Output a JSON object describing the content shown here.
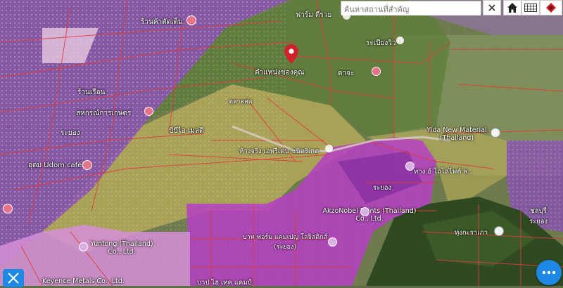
{
  "search": {
    "placeholder": "ค้นหาสถานที่สำคัญ"
  },
  "toolbar": {
    "clear_icon": "close-icon",
    "home_icon": "home-icon",
    "grid_icon": "keyboard-grid-icon",
    "layers_icon": "layers-icon"
  },
  "map": {
    "places": [
      {
        "name": "ร้านค้าตัดเต็ม",
        "type": "poi"
      },
      {
        "name": "ฟาร์ม ตีรวย",
        "type": "poi"
      },
      {
        "name": "ระเบียงวิว",
        "type": "poi"
      },
      {
        "name": "ตำแหน่งของคุณ",
        "type": "pin"
      },
      {
        "name": "ดาจะ",
        "type": "poi"
      },
      {
        "name": "ตลาดสด",
        "type": "road"
      },
      {
        "name": "ร้านเรือน",
        "type": "poi"
      },
      {
        "name": "สหกรณ์การเกษตร",
        "type": "poi"
      },
      {
        "name": "ระยอง",
        "type": "label"
      },
      {
        "name": "บีบีไอ เมลติ",
        "type": "poi"
      },
      {
        "name": "Yida New Material (Thailand)",
        "type": "poi"
      },
      {
        "name": "ห้างจริง เอพรีเด่น ชนิดริเกต",
        "type": "poi"
      },
      {
        "name": "อุดม Udom café",
        "type": "poi"
      },
      {
        "name": "ทาง อ์ โอโลไฟต์ พ..",
        "type": "poi"
      },
      {
        "name": "ระยอง",
        "type": "label"
      },
      {
        "name": "AkzoNobel Paints (Thailand) Co., Ltd.",
        "type": "poi"
      },
      {
        "name": "ชลบุรี ระยอง",
        "type": "label"
      },
      {
        "name": "ทุ่งกะราเภา",
        "type": "poi"
      },
      {
        "name": "Yunfong (Thailand) Co., Ltd.",
        "type": "poi"
      },
      {
        "name": "บาท ฟอร์ม แคมเปญ โลจิสติกส์ (ระยอง)",
        "type": "poi"
      },
      {
        "name": "บาป ไฮ เทค แคมป์",
        "type": "poi"
      },
      {
        "name": "Keyence Metals Co., Ltd.",
        "type": "poi"
      }
    ],
    "colors": {
      "zone_purple": "#8a4fb0",
      "zone_magenta": "#b73bc4",
      "zone_pink": "#d98ad8",
      "zone_green": "#5e7f3a",
      "zone_yellow": "#a6a055",
      "parcel_line": "#e23a3a",
      "pin": "#d0202a",
      "fab": "#1e88e5"
    }
  },
  "fab": {
    "left_icon": "measure-cross-icon",
    "right_icon": "more-dots-icon"
  }
}
